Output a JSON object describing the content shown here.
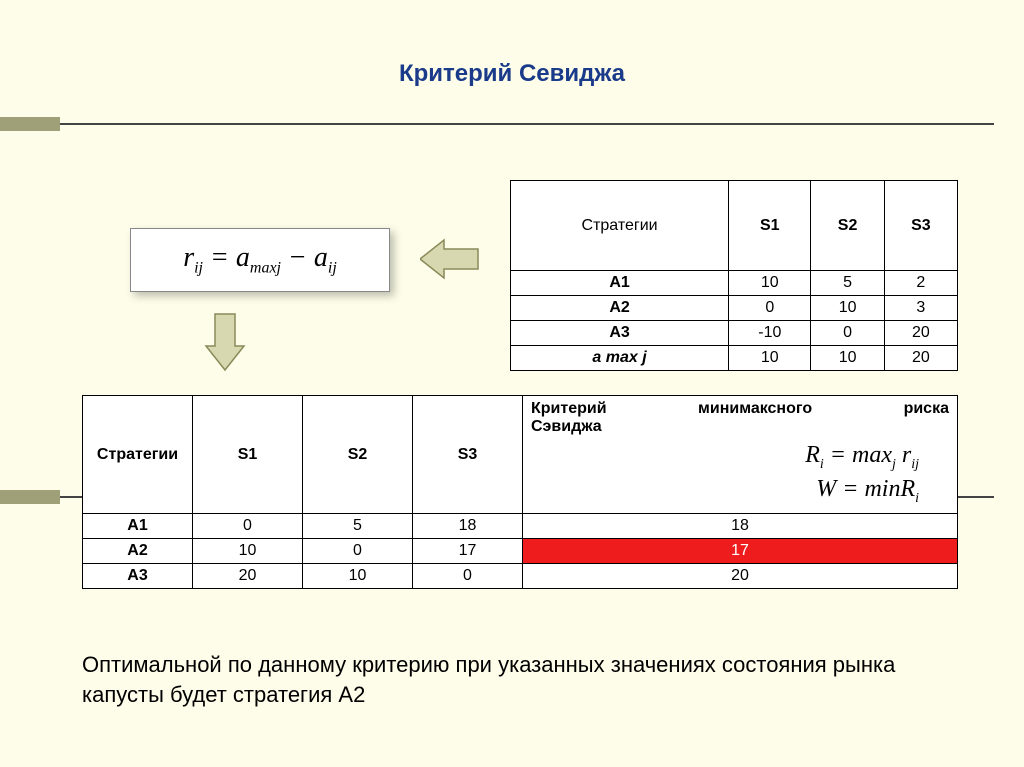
{
  "title": "Критерий Севиджа",
  "formula_html": "r<sub class='sub'>ij</sub> = a<sub class='sub'>maxj</sub> − a<sub class='sub'>ij</sub>",
  "table1": {
    "strategies_label": "Стратегии",
    "cols": [
      "S1",
      "S2",
      "S3"
    ],
    "rows": [
      {
        "label": "А1",
        "vals": [
          "10",
          "5",
          "2"
        ]
      },
      {
        "label": "А2",
        "vals": [
          "0",
          "10",
          "3"
        ]
      },
      {
        "label": "А3",
        "vals": [
          "-10",
          "0",
          "20"
        ]
      },
      {
        "label": "a max j",
        "vals": [
          "10",
          "10",
          "20"
        ],
        "italic": true
      }
    ]
  },
  "table2": {
    "strategies_label": "Стратегии",
    "cols": [
      "S1",
      "S2",
      "S3"
    ],
    "crit_line1a": "Критерий",
    "crit_line1b": "минимаксного",
    "crit_line1c": "риска",
    "crit_line2": "Сэвиджа",
    "crit_formula1_html": "R<sub class='sub'>i</sub> = max<sub class='sub'>j</sub> r<sub class='sub'>ij</sub>",
    "crit_formula2_html": "W = minR<sub class='sub'>i</sub>",
    "rows": [
      {
        "label": "А1",
        "vals": [
          "0",
          "5",
          "18"
        ],
        "result": "18",
        "highlight": false
      },
      {
        "label": "А2",
        "vals": [
          "10",
          "0",
          "17"
        ],
        "result": "17",
        "highlight": true
      },
      {
        "label": "А3",
        "vals": [
          "20",
          "10",
          "0"
        ],
        "result": "20",
        "highlight": false
      }
    ]
  },
  "conclusion": "Оптимальной по данному критерию при указанных значениях состояния рынка капусты будет стратегия А2"
}
